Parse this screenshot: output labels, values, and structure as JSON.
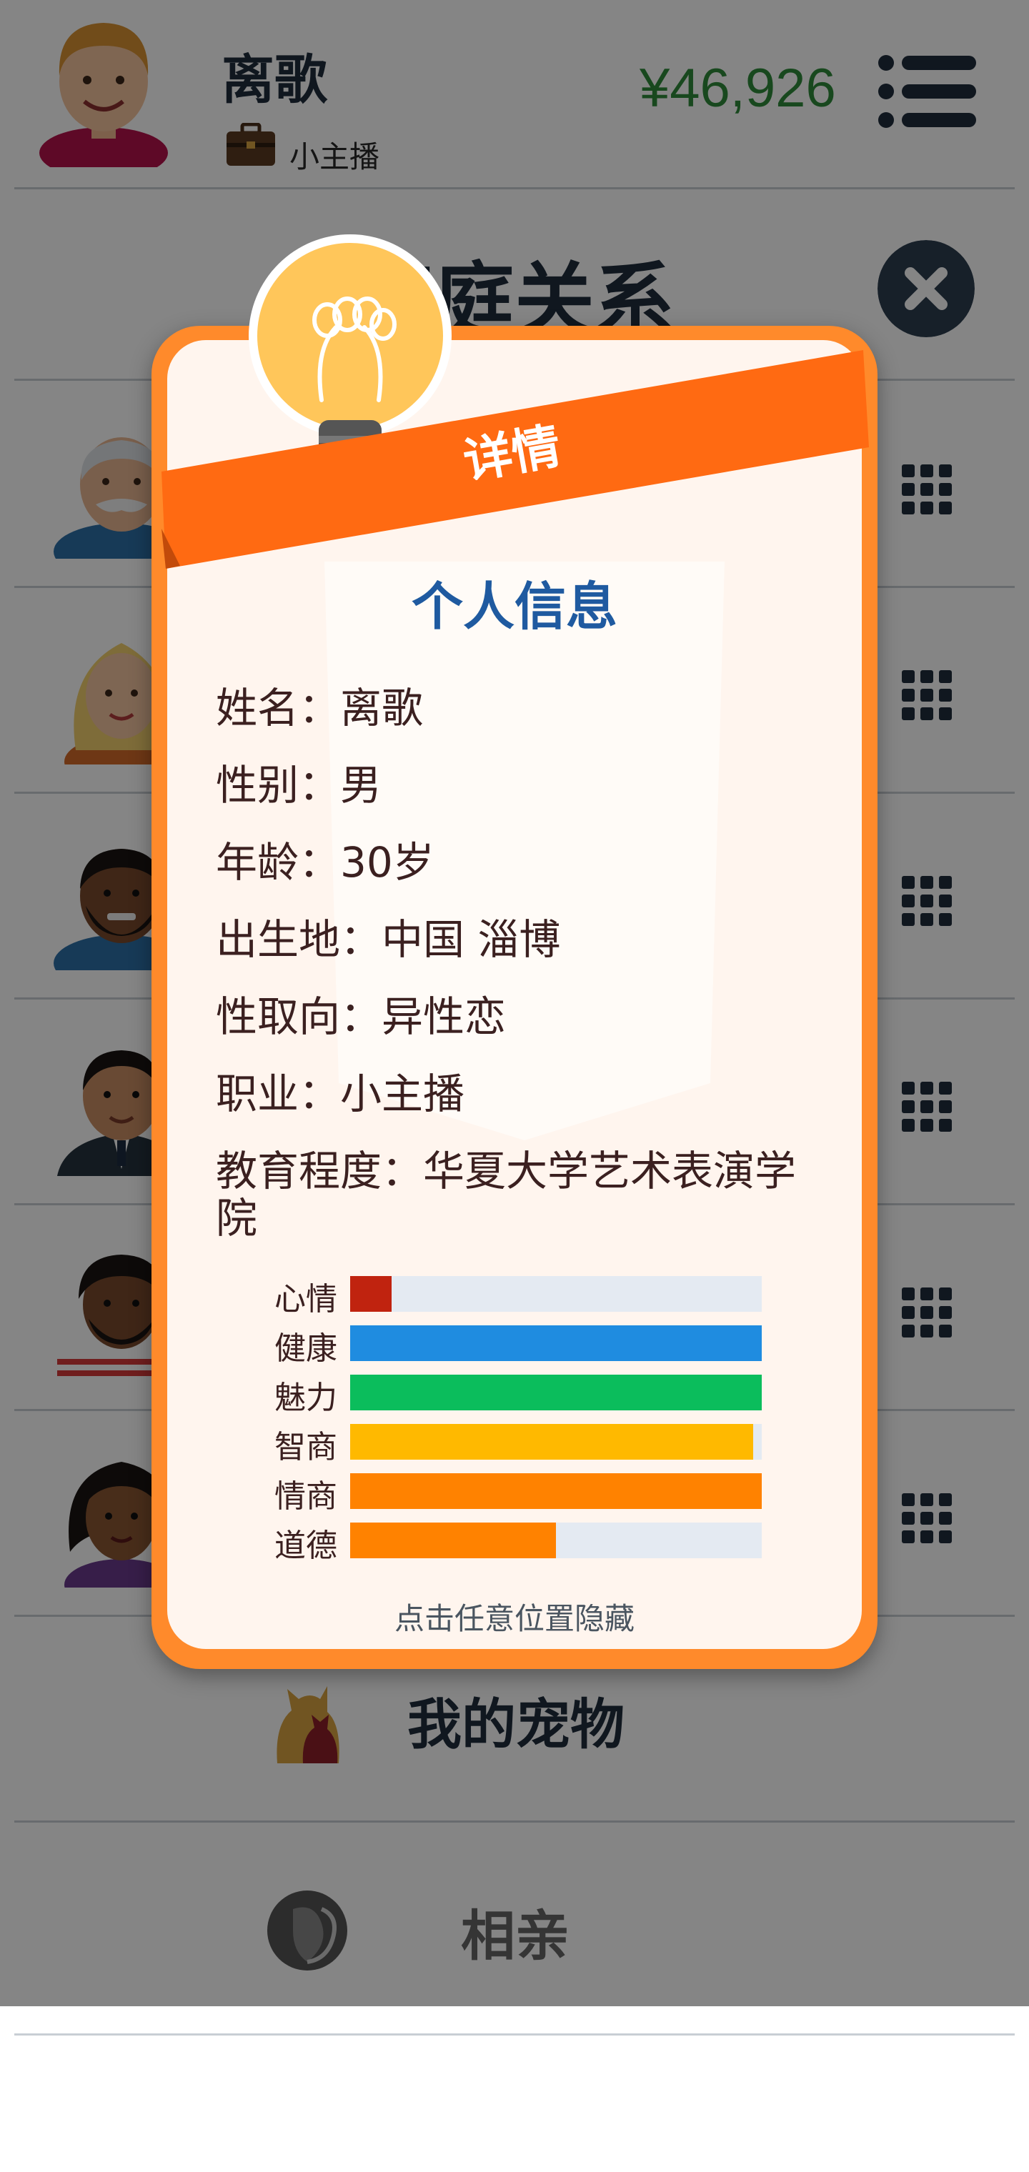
{
  "header": {
    "player_name": "离歌",
    "job_label": "小主播",
    "money": "¥46,926",
    "icons": [
      "avatar",
      "briefcase-icon",
      "list-menu-icon"
    ]
  },
  "section": {
    "title": "家庭关系",
    "close_icon": "close-icon"
  },
  "family_rows": [
    {
      "avatar": "grandfather-avatar",
      "menu_icon": "grid-icon"
    },
    {
      "avatar": "blonde-woman-avatar",
      "menu_icon": "grid-icon"
    },
    {
      "avatar": "bearded-man-avatar",
      "menu_icon": "grid-icon"
    },
    {
      "avatar": "man-in-suit-avatar",
      "menu_icon": "grid-icon"
    },
    {
      "avatar": "curly-haired-man-avatar",
      "menu_icon": "grid-icon"
    },
    {
      "avatar": "curly-haired-woman-avatar",
      "menu_icon": "grid-icon"
    }
  ],
  "pet": {
    "label": "我的宠物",
    "icon": "pet-icon"
  },
  "dating": {
    "label": "相亲",
    "icon": "dating-icon"
  },
  "modal": {
    "ribbon_label": "详情",
    "bulb_icon": "lightbulb-icon",
    "info_title": "个人信息",
    "lines": [
      "姓名：离歌",
      "性别：男",
      "年龄：30岁",
      "出生地：中国 淄博",
      "性取向：异性恋",
      "职业：小主播",
      "教育程度：华夏大学艺术表演学院"
    ],
    "stats": [
      {
        "label": "心情",
        "value": 0.1,
        "color": "#c0230f"
      },
      {
        "label": "健康",
        "value": 1.0,
        "color": "#1f8ce0"
      },
      {
        "label": "魅力",
        "value": 1.0,
        "color": "#0bbd5c"
      },
      {
        "label": "智商",
        "value": 0.98,
        "color": "#ffb900"
      },
      {
        "label": "情商",
        "value": 1.0,
        "color": "#ff8200"
      },
      {
        "label": "道德",
        "value": 0.5,
        "color": "#ff8200"
      }
    ],
    "hint": "点击任意位置隐藏"
  }
}
